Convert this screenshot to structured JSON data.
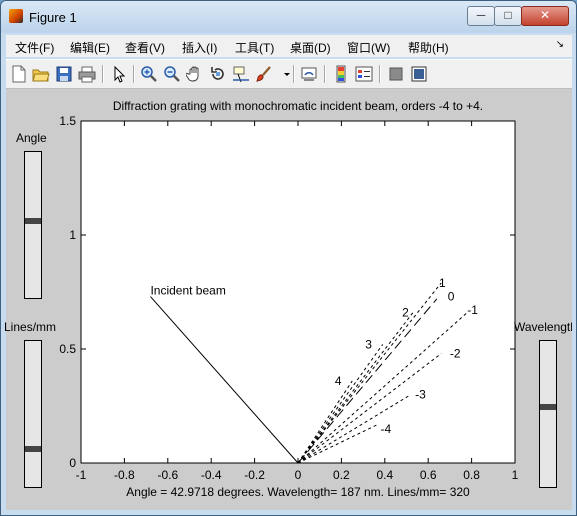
{
  "window": {
    "title": "Figure 1",
    "buttons": {
      "minimize": "─",
      "maximize": "□",
      "close": "✕"
    }
  },
  "menu": {
    "items": [
      "文件(F)",
      "编辑(E)",
      "查看(V)",
      "插入(I)",
      "工具(T)",
      "桌面(D)",
      "窗口(W)",
      "帮助(H)"
    ],
    "overflow_glyph": "↘"
  },
  "toolbar": {
    "icons": [
      "new-figure-icon",
      "open-file-icon",
      "save-icon",
      "print-icon",
      "pointer-icon",
      "zoom-in-icon",
      "zoom-out-icon",
      "pan-hand-icon",
      "rotate-3d-icon",
      "data-cursor-icon",
      "brush-icon",
      "link-icon",
      "colorbar-icon",
      "legend-icon",
      "hide-plot-tools-icon",
      "show-plot-tools-icon"
    ]
  },
  "plot": {
    "title": "Diffraction grating with monochromatic incident beam, orders -4 to +4.",
    "xlabel": "Angle = 42.9718 degrees.    Wavelength= 187 nm.  Lines/mm= 320",
    "background": "#ffffff"
  },
  "sliders": {
    "angle": {
      "label": "Angle",
      "value": 0.53
    },
    "lines": {
      "label": "Lines/mm",
      "value": 0.25
    },
    "wavelength": {
      "label": "Wavelength",
      "value": 0.55
    }
  },
  "chart_data": {
    "type": "line",
    "xlim": [
      -1,
      1
    ],
    "ylim": [
      0,
      1.5
    ],
    "xticks": [
      -1,
      -0.8,
      -0.6,
      -0.4,
      -0.2,
      0,
      0.2,
      0.4,
      0.6,
      0.8,
      1
    ],
    "yticks": [
      0,
      0.5,
      1,
      1.5
    ],
    "tick_labels_x": [
      "-1",
      "-0.8",
      "-0.6",
      "-0.4",
      "-0.2",
      "0",
      "0.2",
      "0.4",
      "0.6",
      "0.8",
      "1"
    ],
    "tick_labels_y": [
      "0",
      "0.5",
      "1",
      "1.5"
    ],
    "grid": false,
    "incident_beam": {
      "label": "Incident beam",
      "x": [
        -0.68,
        0
      ],
      "y": [
        0.73,
        0
      ]
    },
    "orders": [
      {
        "order": "1",
        "x": [
          0,
          0.66
        ],
        "y": [
          0,
          0.79
        ],
        "label_x": 0.65,
        "label_y": 0.79
      },
      {
        "order": "0",
        "x": [
          0,
          0.64
        ],
        "y": [
          0,
          0.72
        ],
        "label_x": 0.69,
        "label_y": 0.73
      },
      {
        "order": "2",
        "x": [
          0,
          0.53
        ],
        "y": [
          0,
          0.66
        ],
        "label_x": 0.48,
        "label_y": 0.66
      },
      {
        "order": "-1",
        "x": [
          0,
          0.78
        ],
        "y": [
          0,
          0.66
        ],
        "label_x": 0.78,
        "label_y": 0.67
      },
      {
        "order": "3",
        "x": [
          0,
          0.39
        ],
        "y": [
          0,
          0.52
        ],
        "label_x": 0.31,
        "label_y": 0.52
      },
      {
        "order": "-2",
        "x": [
          0,
          0.66
        ],
        "y": [
          0,
          0.48
        ],
        "label_x": 0.7,
        "label_y": 0.48
      },
      {
        "order": "4",
        "x": [
          0,
          0.25
        ],
        "y": [
          0,
          0.36
        ],
        "label_x": 0.17,
        "label_y": 0.36
      },
      {
        "order": "-3",
        "x": [
          0,
          0.52
        ],
        "y": [
          0,
          0.3
        ],
        "label_x": 0.54,
        "label_y": 0.3
      },
      {
        "order": "-4",
        "x": [
          0,
          0.37
        ],
        "y": [
          0,
          0.17
        ],
        "label_x": 0.38,
        "label_y": 0.15
      }
    ]
  }
}
